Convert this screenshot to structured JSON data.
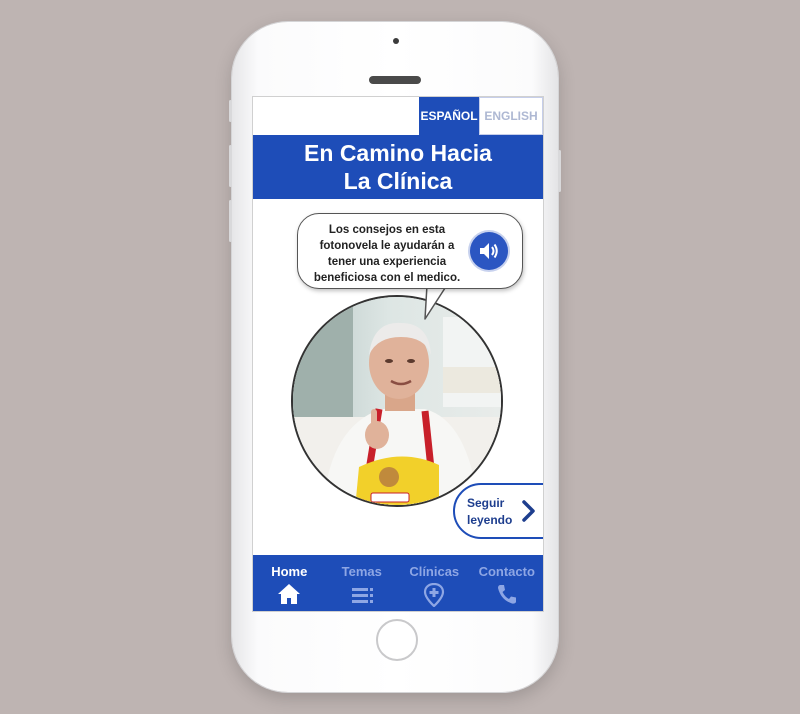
{
  "language": {
    "active": "ESPAÑOL",
    "inactive": "ENGLISH"
  },
  "header": {
    "title_line1": "En Camino Hacia",
    "title_line2": "La Clínica"
  },
  "bubble": {
    "text": "Los consejos en esta fotonovela le ayudarán a tener una experiencia beneficiosa con el medico.",
    "audio_icon": "speaker-icon"
  },
  "next": {
    "label": "Seguir leyendo",
    "icon": "chevron-right-icon"
  },
  "tabs": [
    {
      "label": "Home",
      "icon": "home-icon",
      "active": true
    },
    {
      "label": "Temas",
      "icon": "list-icon",
      "active": false
    },
    {
      "label": "Clínicas",
      "icon": "map-pin-icon",
      "active": false
    },
    {
      "label": "Contacto",
      "icon": "phone-icon",
      "active": false
    }
  ],
  "colors": {
    "primary": "#1e4db8",
    "inactive_tab": "#8ea6e4",
    "background": "#beb4b2"
  }
}
